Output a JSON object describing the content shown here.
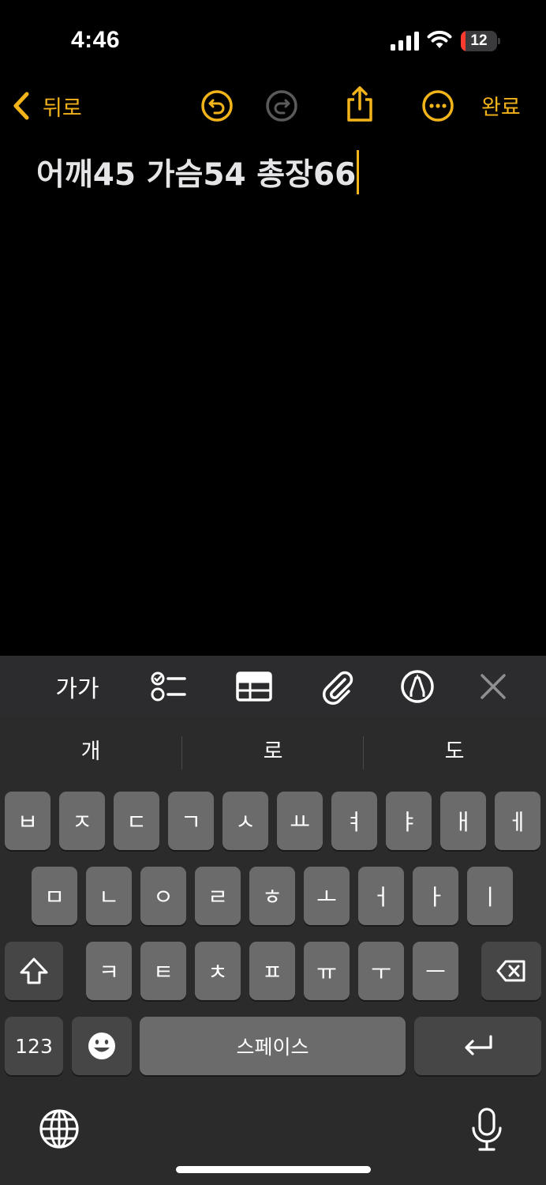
{
  "status_bar": {
    "time": "4:46",
    "battery_level": "12",
    "battery_fraction": 0.12,
    "battery_color": "#ff3b30",
    "icons": [
      "cellular-signal-icon",
      "wifi-icon",
      "battery-icon"
    ]
  },
  "nav": {
    "back_label": "뒤로",
    "done_label": "완료",
    "accent_color": "#f2b41a",
    "icons": [
      "chevron-left-icon",
      "undo-icon",
      "redo-icon",
      "share-icon",
      "more-icon"
    ]
  },
  "note": {
    "text": "어깨45 가슴54 총장66"
  },
  "format_toolbar": {
    "text_style_label": "가가",
    "icons": [
      "checklist-icon",
      "table-icon",
      "paperclip-icon",
      "markup-pen-icon",
      "close-icon"
    ]
  },
  "keyboard": {
    "suggestions": [
      "개",
      "로",
      "도"
    ],
    "row1": [
      "ㅂ",
      "ㅈ",
      "ㄷ",
      "ㄱ",
      "ㅅ",
      "ㅛ",
      "ㅕ",
      "ㅑ",
      "ㅐ",
      "ㅔ"
    ],
    "row2": [
      "ㅁ",
      "ㄴ",
      "ㅇ",
      "ㄹ",
      "ㅎ",
      "ㅗ",
      "ㅓ",
      "ㅏ",
      "ㅣ"
    ],
    "row3": [
      "ㅋ",
      "ㅌ",
      "ㅊ",
      "ㅍ",
      "ㅠ",
      "ㅜ",
      "ㅡ"
    ],
    "numbers_label": "123",
    "space_label": "스페이스",
    "icons": [
      "shift-icon",
      "delete-icon",
      "emoji-icon",
      "return-icon",
      "globe-icon",
      "microphone-icon"
    ]
  }
}
